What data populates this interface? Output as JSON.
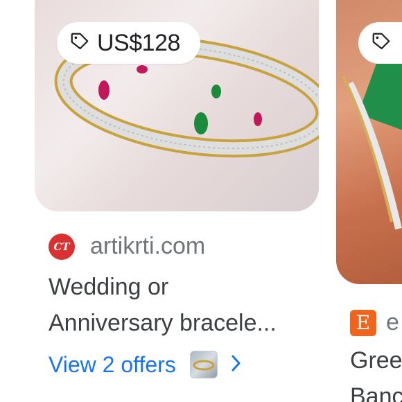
{
  "cards": [
    {
      "price": "US$128",
      "source": {
        "logo_text": "CT",
        "name": "artikrti.com"
      },
      "title_lines": [
        "Wedding or",
        "Anniversary bracele..."
      ],
      "offers_label": "View 2 offers",
      "icons": {
        "tag": "tag-icon",
        "chevron": "chevron-right-icon"
      },
      "colors": {
        "link": "#1a73e8",
        "logo_bg": "#d93030"
      }
    },
    {
      "source": {
        "logo_text": "E",
        "name": "e"
      },
      "title_lines": [
        "Gree",
        "Banc"
      ],
      "colors": {
        "logo_bg": "#f1641e"
      }
    }
  ]
}
